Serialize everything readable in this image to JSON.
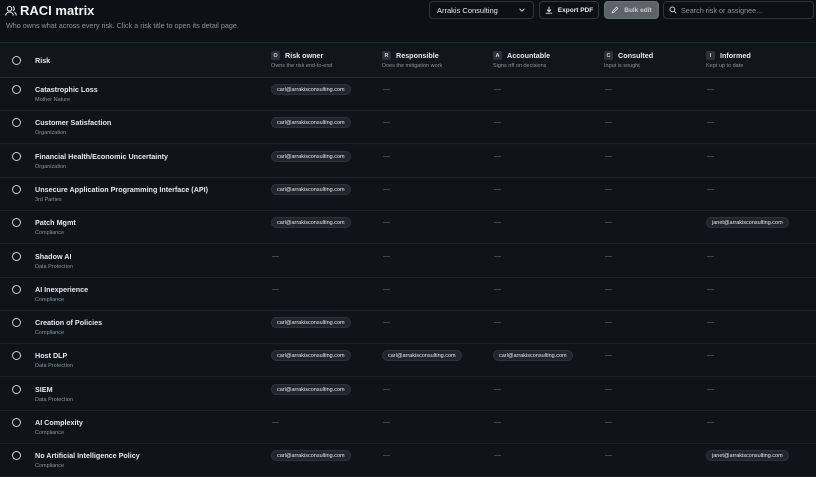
{
  "header": {
    "title": "RACI matrix",
    "subtitle": "Who owns what across every risk. Click a risk title to open its detail page.",
    "org_select": "Arrakis Consulting",
    "export_label": "Export PDF",
    "bulk_label": "Bulk edit",
    "search_placeholder": "Search risk or assignee..."
  },
  "columns": {
    "risk": "Risk",
    "owner": {
      "badge": "O",
      "label": "Risk owner",
      "sub": "Owns the risk end-to-end"
    },
    "responsible": {
      "badge": "R",
      "label": "Responsible",
      "sub": "Does the mitigation work"
    },
    "accountable": {
      "badge": "A",
      "label": "Accountable",
      "sub": "Signs off on decisions"
    },
    "consulted": {
      "badge": "C",
      "label": "Consulted",
      "sub": "Input is sought"
    },
    "informed": {
      "badge": "I",
      "label": "Informed",
      "sub": "Kept up to date"
    }
  },
  "rows": [
    {
      "name": "Catastrophic Loss",
      "category": "Mother Nature",
      "owner": "carl@arrakisconsulting.com",
      "responsible": "—",
      "accountable": "—",
      "consulted": "—",
      "informed": "—"
    },
    {
      "name": "Customer Satisfaction",
      "category": "Organization",
      "owner": "carl@arrakisconsulting.com",
      "responsible": "—",
      "accountable": "—",
      "consulted": "—",
      "informed": "—"
    },
    {
      "name": "Financial Health/Economic Uncertainty",
      "category": "Organization",
      "owner": "carl@arrakisconsulting.com",
      "responsible": "—",
      "accountable": "—",
      "consulted": "—",
      "informed": "—"
    },
    {
      "name": "Unsecure Application Programming Interface (API)",
      "category": "3rd Parties",
      "owner": "carl@arrakisconsulting.com",
      "responsible": "—",
      "accountable": "—",
      "consulted": "—",
      "informed": "—"
    },
    {
      "name": "Patch Mgmt",
      "category": "Compliance",
      "owner": "carl@arrakisconsulting.com",
      "responsible": "—",
      "accountable": "—",
      "consulted": "—",
      "informed": "janet@arrakisconsulting.com"
    },
    {
      "name": "Shadow AI",
      "category": "Data Protection",
      "owner": "—",
      "responsible": "—",
      "accountable": "—",
      "consulted": "—",
      "informed": "—"
    },
    {
      "name": "AI Inexperience",
      "category": "Compliance",
      "owner": "—",
      "responsible": "—",
      "accountable": "—",
      "consulted": "—",
      "informed": "—"
    },
    {
      "name": "Creation of Policies",
      "category": "Compliance",
      "owner": "carl@arrakisconsulting.com",
      "responsible": "—",
      "accountable": "—",
      "consulted": "—",
      "informed": "—"
    },
    {
      "name": "Host DLP",
      "category": "Data Protection",
      "owner": "carl@arrakisconsulting.com",
      "responsible": "carl@arrakisconsulting.com",
      "accountable": "carl@arrakisconsulting.com",
      "consulted": "—",
      "informed": "—"
    },
    {
      "name": "SIEM",
      "category": "Data Protection",
      "owner": "carl@arrakisconsulting.com",
      "responsible": "—",
      "accountable": "—",
      "consulted": "—",
      "informed": "—"
    },
    {
      "name": "AI Complexity",
      "category": "Compliance",
      "owner": "—",
      "responsible": "—",
      "accountable": "—",
      "consulted": "—",
      "informed": "—"
    },
    {
      "name": "No Artificial Intelligence Policy",
      "category": "Compliance",
      "owner": "carl@arrakisconsulting.com",
      "responsible": "—",
      "accountable": "—",
      "consulted": "—",
      "informed": "janet@arrakisconsulting.com"
    }
  ]
}
